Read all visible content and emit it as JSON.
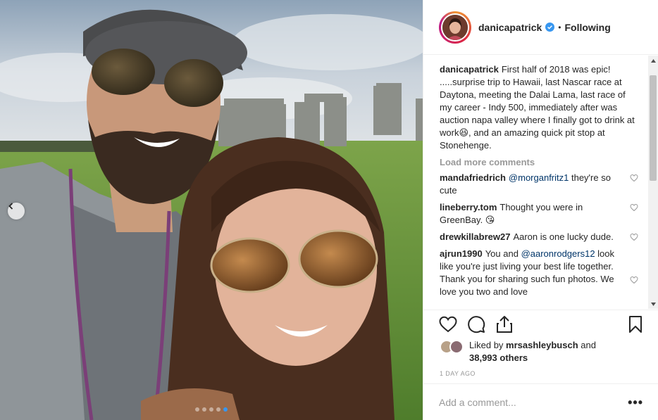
{
  "post": {
    "username": "danicapatrick",
    "separator": "•",
    "follow_label": "Following",
    "verified_icon": "verified-badge-icon",
    "accent_color": "#3897f0",
    "caption": {
      "username": "danicapatrick",
      "text": "First half of 2018 was epic! .....surprise trip to Hawaii, last Nascar race at Daytona, meeting the Dalai Lama, last race of my career - Indy 500, immediately after was auction napa valley where I finally got to drink at work😆, and an amazing quick pit stop at Stonehenge."
    },
    "load_more_label": "Load more comments",
    "comments": [
      {
        "username": "mandafriedrich",
        "mention": "@morganfritz1",
        "text": " they're so cute"
      },
      {
        "username": "lineberry.tom",
        "mention": "",
        "text": "Thought you were in GreenBay. 😘"
      },
      {
        "username": "drewkillabrew27",
        "mention": "",
        "text": "Aaron is one lucky dude."
      },
      {
        "username": "ajrun1990",
        "text_before": "You and ",
        "mention": "@aaronrodgers12",
        "text": " look like you're just living your best life together. Thank you for sharing such fun photos. We love you two and love"
      }
    ],
    "likes": {
      "prefix": "Liked by ",
      "liker": "mrsashleybusch",
      "middle": " and ",
      "others": "38,993 others"
    },
    "timestamp": "1 DAY AGO",
    "add_comment_placeholder": "Add a comment...",
    "more_label": "•••",
    "carousel": {
      "total": 5,
      "active_index": 4
    }
  }
}
